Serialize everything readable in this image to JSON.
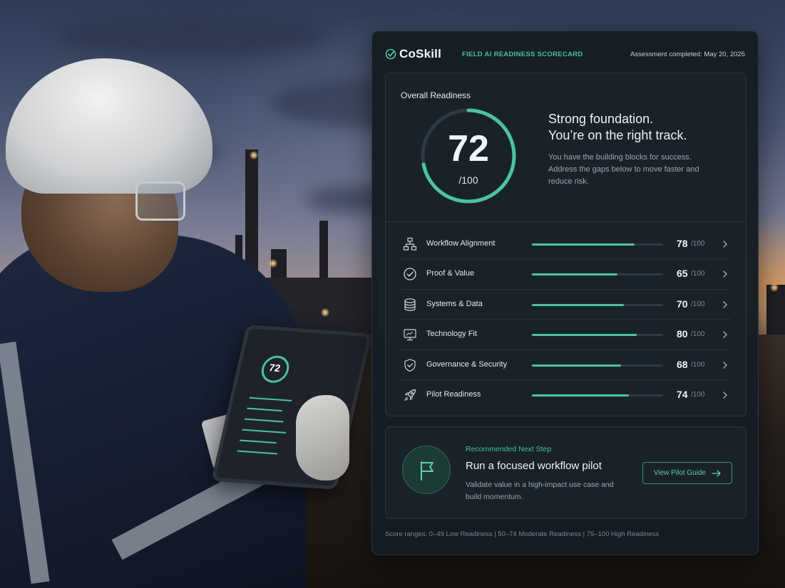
{
  "header": {
    "brand": "CoSkill",
    "scorecard_title": "FIELD AI READINESS SCORECARD",
    "assessment_date": "Assessment completed: May 20, 2025"
  },
  "overall": {
    "label": "Overall Readiness",
    "score": "72",
    "max": "/100",
    "progress": 0.72,
    "headline_line1": "Strong foundation.",
    "headline_line2": "You’re on the right track.",
    "description": "You have the building blocks for success. Address the gaps below to move faster and reduce risk."
  },
  "metrics": [
    {
      "label": "Workflow Alignment",
      "score": "78",
      "max": "/100",
      "value": 78,
      "icon": "workflow-icon"
    },
    {
      "label": "Proof & Value",
      "score": "65",
      "max": "/100",
      "value": 65,
      "icon": "check-circle-icon"
    },
    {
      "label": "Systems & Data",
      "score": "70",
      "max": "/100",
      "value": 70,
      "icon": "database-icon"
    },
    {
      "label": "Technology Fit",
      "score": "80",
      "max": "/100",
      "value": 80,
      "icon": "monitor-icon"
    },
    {
      "label": "Governance & Security",
      "score": "68",
      "max": "/100",
      "value": 68,
      "icon": "shield-check-icon"
    },
    {
      "label": "Pilot Readiness",
      "score": "74",
      "max": "/100",
      "value": 74,
      "icon": "rocket-icon"
    }
  ],
  "next_step": {
    "label": "Recommended Next Step",
    "title": "Run a focused workflow pilot",
    "description": "Validate value in a high-impact use case and build momentum.",
    "button_label": "View Pilot Guide",
    "icon": "flag-icon"
  },
  "footer": {
    "ranges": "Score ranges: 0–49 Low Readiness  |  50–74 Moderate Readiness  |  75–100 High Readiness"
  },
  "tablet_preview": {
    "score": "72"
  },
  "colors": {
    "accent": "#4cc3a0",
    "panel_bg": "#151c23",
    "card_bg": "#1a2229"
  }
}
